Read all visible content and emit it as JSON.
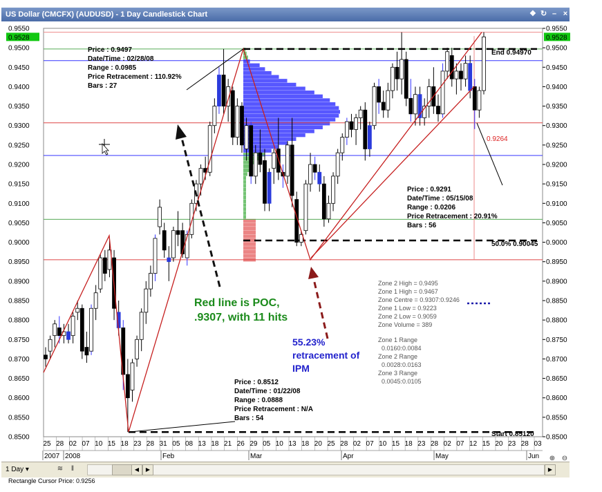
{
  "window": {
    "title": "US Dollar (CMCFX) (AUDUSD) - 1 Day Candlestick Chart",
    "status": "Rectangle Cursor Price: 0.9256",
    "period": "1 Day"
  },
  "chart_data": {
    "type": "candlestick",
    "ylim": [
      0.85,
      0.955
    ],
    "yticks": [
      "0.9550",
      "0.9500",
      "0.9450",
      "0.9400",
      "0.9350",
      "0.9300",
      "0.9250",
      "0.9200",
      "0.9150",
      "0.9100",
      "0.9050",
      "0.9000",
      "0.8950",
      "0.8900",
      "0.8850",
      "0.8800",
      "0.8750",
      "0.8700",
      "0.8650",
      "0.8600",
      "0.8550",
      "0.8500"
    ],
    "current_price_label": "0.9528",
    "current_price": 0.9528,
    "xtick_days": [
      "25",
      "28",
      "02",
      "07",
      "10",
      "15",
      "18",
      "23",
      "28",
      "31",
      "05",
      "08",
      "13",
      "18",
      "21",
      "26",
      "29",
      "05",
      "10",
      "13",
      "18",
      "20",
      "25",
      "28",
      "02",
      "07",
      "10",
      "15",
      "18",
      "23",
      "28",
      "02",
      "07",
      "12",
      "15",
      "20",
      "23",
      "28",
      "03"
    ],
    "month_labels": [
      "2007",
      "2008",
      "Feb",
      "Mar",
      "Apr",
      "May",
      "Jun"
    ],
    "lines": [
      {
        "label": "End 0.94970",
        "price": 0.9497,
        "style": "dashed"
      },
      {
        "label": "50.0% 0.90045",
        "price": 0.90045,
        "style": "dashed"
      },
      {
        "label": "Start 0.85120",
        "price": 0.8512,
        "style": "dashed"
      },
      {
        "label": "0.9264",
        "price": 0.9264,
        "style": "marker"
      }
    ],
    "callouts": [
      {
        "lines": [
          "Price : 0.9497",
          "Date/Time : 02/28/08",
          "Range : 0.0985",
          "Price Retracement : 110.92%",
          "Bars : 27"
        ]
      },
      {
        "lines": [
          "Price : 0.9291",
          "Date/Time : 05/15/08",
          "Range : 0.0206",
          "Price Retracement : 20.91%",
          "Bars : 56"
        ]
      },
      {
        "lines": [
          "Price : 0.8512",
          "Date/Time : 01/22/08",
          "Range : 0.0888",
          "Price Retracement : N/A",
          "Bars : 54"
        ]
      }
    ],
    "zone_stats": [
      "Zone 2 High = 0.9495",
      "Zone 1 High = 0.9467",
      "Zone Centre = 0.9307:0.9246",
      "Zone 1 Low = 0.9223",
      "Zone 2 Low = 0.9059",
      "Zone Volume = 389"
    ],
    "zone_ranges": [
      "Zone 1 Range",
      "0.0160:0.0084",
      "Zone 2 Range",
      "0.0028:0.0163",
      "Zone 3 Range",
      "0.0045:0.0105"
    ],
    "annotations": [
      {
        "text": [
          "Red line is POC,",
          ".9307, with 11 hits"
        ],
        "color": "#1a8a1a"
      },
      {
        "text": [
          "55.23%",
          "retracement of",
          "IPM"
        ],
        "color": "#2222cc"
      }
    ],
    "candles": [
      {
        "o": 0.871,
        "h": 0.873,
        "l": 0.868,
        "c": 0.87
      },
      {
        "o": 0.872,
        "h": 0.876,
        "l": 0.87,
        "c": 0.875
      },
      {
        "o": 0.876,
        "h": 0.88,
        "l": 0.873,
        "c": 0.879
      },
      {
        "o": 0.878,
        "h": 0.881,
        "l": 0.874,
        "c": 0.876
      },
      {
        "o": 0.876,
        "h": 0.879,
        "l": 0.874,
        "c": 0.877
      },
      {
        "o": 0.877,
        "h": 0.879,
        "l": 0.874,
        "c": 0.875
      },
      {
        "o": 0.876,
        "h": 0.882,
        "l": 0.874,
        "c": 0.881
      },
      {
        "o": 0.882,
        "h": 0.885,
        "l": 0.88,
        "c": 0.883
      },
      {
        "o": 0.883,
        "h": 0.884,
        "l": 0.87,
        "c": 0.872
      },
      {
        "o": 0.873,
        "h": 0.877,
        "l": 0.869,
        "c": 0.871
      },
      {
        "o": 0.872,
        "h": 0.884,
        "l": 0.871,
        "c": 0.883
      },
      {
        "o": 0.883,
        "h": 0.889,
        "l": 0.88,
        "c": 0.887
      },
      {
        "o": 0.888,
        "h": 0.897,
        "l": 0.887,
        "c": 0.896
      },
      {
        "o": 0.896,
        "h": 0.898,
        "l": 0.89,
        "c": 0.892
      },
      {
        "o": 0.893,
        "h": 0.901,
        "l": 0.891,
        "c": 0.898
      },
      {
        "o": 0.896,
        "h": 0.898,
        "l": 0.88,
        "c": 0.883
      },
      {
        "o": 0.882,
        "h": 0.885,
        "l": 0.876,
        "c": 0.878
      },
      {
        "o": 0.878,
        "h": 0.88,
        "l": 0.862,
        "c": 0.866
      },
      {
        "o": 0.866,
        "h": 0.87,
        "l": 0.8512,
        "c": 0.86
      },
      {
        "o": 0.862,
        "h": 0.87,
        "l": 0.859,
        "c": 0.869
      },
      {
        "o": 0.87,
        "h": 0.876,
        "l": 0.868,
        "c": 0.875
      },
      {
        "o": 0.875,
        "h": 0.883,
        "l": 0.872,
        "c": 0.882
      },
      {
        "o": 0.882,
        "h": 0.89,
        "l": 0.879,
        "c": 0.888
      },
      {
        "o": 0.888,
        "h": 0.894,
        "l": 0.886,
        "c": 0.892
      },
      {
        "o": 0.892,
        "h": 0.902,
        "l": 0.89,
        "c": 0.901
      },
      {
        "o": 0.904,
        "h": 0.911,
        "l": 0.902,
        "c": 0.909
      },
      {
        "o": 0.903,
        "h": 0.905,
        "l": 0.896,
        "c": 0.898
      },
      {
        "o": 0.896,
        "h": 0.899,
        "l": 0.89,
        "c": 0.895
      },
      {
        "o": 0.896,
        "h": 0.904,
        "l": 0.895,
        "c": 0.903
      },
      {
        "o": 0.903,
        "h": 0.908,
        "l": 0.899,
        "c": 0.902
      },
      {
        "o": 0.903,
        "h": 0.905,
        "l": 0.896,
        "c": 0.897
      },
      {
        "o": 0.896,
        "h": 0.903,
        "l": 0.894,
        "c": 0.902
      },
      {
        "o": 0.902,
        "h": 0.911,
        "l": 0.901,
        "c": 0.91
      },
      {
        "o": 0.91,
        "h": 0.916,
        "l": 0.908,
        "c": 0.915
      },
      {
        "o": 0.915,
        "h": 0.92,
        "l": 0.912,
        "c": 0.919
      },
      {
        "o": 0.919,
        "h": 0.922,
        "l": 0.916,
        "c": 0.918
      },
      {
        "o": 0.918,
        "h": 0.931,
        "l": 0.917,
        "c": 0.93
      },
      {
        "o": 0.93,
        "h": 0.937,
        "l": 0.928,
        "c": 0.935
      },
      {
        "o": 0.935,
        "h": 0.945,
        "l": 0.933,
        "c": 0.943
      },
      {
        "o": 0.943,
        "h": 0.9497,
        "l": 0.933,
        "c": 0.935
      },
      {
        "o": 0.935,
        "h": 0.942,
        "l": 0.931,
        "c": 0.94
      },
      {
        "o": 0.939,
        "h": 0.94,
        "l": 0.925,
        "c": 0.927
      },
      {
        "o": 0.927,
        "h": 0.937,
        "l": 0.925,
        "c": 0.935
      },
      {
        "o": 0.935,
        "h": 0.936,
        "l": 0.923,
        "c": 0.925
      },
      {
        "o": 0.924,
        "h": 0.932,
        "l": 0.921,
        "c": 0.93
      },
      {
        "o": 0.93,
        "h": 0.931,
        "l": 0.915,
        "c": 0.917
      },
      {
        "o": 0.917,
        "h": 0.925,
        "l": 0.915,
        "c": 0.923
      },
      {
        "o": 0.923,
        "h": 0.929,
        "l": 0.918,
        "c": 0.92
      },
      {
        "o": 0.921,
        "h": 0.924,
        "l": 0.908,
        "c": 0.91
      },
      {
        "o": 0.91,
        "h": 0.919,
        "l": 0.908,
        "c": 0.918
      },
      {
        "o": 0.919,
        "h": 0.924,
        "l": 0.915,
        "c": 0.923
      },
      {
        "o": 0.924,
        "h": 0.932,
        "l": 0.916,
        "c": 0.918
      },
      {
        "o": 0.918,
        "h": 0.92,
        "l": 0.914,
        "c": 0.917
      },
      {
        "o": 0.917,
        "h": 0.926,
        "l": 0.915,
        "c": 0.925
      },
      {
        "o": 0.925,
        "h": 0.932,
        "l": 0.909,
        "c": 0.912
      },
      {
        "o": 0.911,
        "h": 0.913,
        "l": 0.899,
        "c": 0.9
      },
      {
        "o": 0.9,
        "h": 0.903,
        "l": 0.899,
        "c": 0.902
      },
      {
        "o": 0.903,
        "h": 0.916,
        "l": 0.902,
        "c": 0.915
      },
      {
        "o": 0.915,
        "h": 0.923,
        "l": 0.913,
        "c": 0.92
      },
      {
        "o": 0.92,
        "h": 0.922,
        "l": 0.916,
        "c": 0.918
      },
      {
        "o": 0.918,
        "h": 0.92,
        "l": 0.913,
        "c": 0.915
      },
      {
        "o": 0.915,
        "h": 0.917,
        "l": 0.904,
        "c": 0.906
      },
      {
        "o": 0.906,
        "h": 0.912,
        "l": 0.905,
        "c": 0.91
      },
      {
        "o": 0.91,
        "h": 0.918,
        "l": 0.908,
        "c": 0.917
      },
      {
        "o": 0.917,
        "h": 0.924,
        "l": 0.915,
        "c": 0.923
      },
      {
        "o": 0.923,
        "h": 0.928,
        "l": 0.921,
        "c": 0.927
      },
      {
        "o": 0.927,
        "h": 0.932,
        "l": 0.925,
        "c": 0.931
      },
      {
        "o": 0.931,
        "h": 0.933,
        "l": 0.927,
        "c": 0.929
      },
      {
        "o": 0.929,
        "h": 0.933,
        "l": 0.925,
        "c": 0.932
      },
      {
        "o": 0.932,
        "h": 0.935,
        "l": 0.929,
        "c": 0.934
      },
      {
        "o": 0.934,
        "h": 0.936,
        "l": 0.921,
        "c": 0.924
      },
      {
        "o": 0.924,
        "h": 0.931,
        "l": 0.922,
        "c": 0.93
      },
      {
        "o": 0.93,
        "h": 0.941,
        "l": 0.929,
        "c": 0.94
      },
      {
        "o": 0.94,
        "h": 0.942,
        "l": 0.933,
        "c": 0.936
      },
      {
        "o": 0.936,
        "h": 0.939,
        "l": 0.932,
        "c": 0.934
      },
      {
        "o": 0.934,
        "h": 0.941,
        "l": 0.932,
        "c": 0.939
      },
      {
        "o": 0.939,
        "h": 0.946,
        "l": 0.937,
        "c": 0.945
      },
      {
        "o": 0.945,
        "h": 0.949,
        "l": 0.939,
        "c": 0.942
      },
      {
        "o": 0.942,
        "h": 0.954,
        "l": 0.938,
        "c": 0.947
      },
      {
        "o": 0.947,
        "h": 0.949,
        "l": 0.935,
        "c": 0.937
      },
      {
        "o": 0.937,
        "h": 0.942,
        "l": 0.931,
        "c": 0.933
      },
      {
        "o": 0.933,
        "h": 0.94,
        "l": 0.93,
        "c": 0.938
      },
      {
        "o": 0.938,
        "h": 0.94,
        "l": 0.93,
        "c": 0.932
      },
      {
        "o": 0.932,
        "h": 0.937,
        "l": 0.93,
        "c": 0.935
      },
      {
        "o": 0.935,
        "h": 0.942,
        "l": 0.932,
        "c": 0.94
      },
      {
        "o": 0.94,
        "h": 0.945,
        "l": 0.933,
        "c": 0.935
      },
      {
        "o": 0.935,
        "h": 0.938,
        "l": 0.931,
        "c": 0.933
      },
      {
        "o": 0.933,
        "h": 0.946,
        "l": 0.932,
        "c": 0.944
      },
      {
        "o": 0.944,
        "h": 0.95,
        "l": 0.942,
        "c": 0.949
      },
      {
        "o": 0.948,
        "h": 0.95,
        "l": 0.94,
        "c": 0.942
      },
      {
        "o": 0.942,
        "h": 0.946,
        "l": 0.938,
        "c": 0.944
      },
      {
        "o": 0.944,
        "h": 0.946,
        "l": 0.939,
        "c": 0.942
      },
      {
        "o": 0.942,
        "h": 0.948,
        "l": 0.94,
        "c": 0.946
      },
      {
        "o": 0.946,
        "h": 0.948,
        "l": 0.937,
        "c": 0.939
      },
      {
        "o": 0.94,
        "h": 0.942,
        "l": 0.9291,
        "c": 0.934
      },
      {
        "o": 0.934,
        "h": 0.94,
        "l": 0.932,
        "c": 0.939
      },
      {
        "o": 0.939,
        "h": 0.954,
        "l": 0.938,
        "c": 0.9528
      }
    ]
  }
}
